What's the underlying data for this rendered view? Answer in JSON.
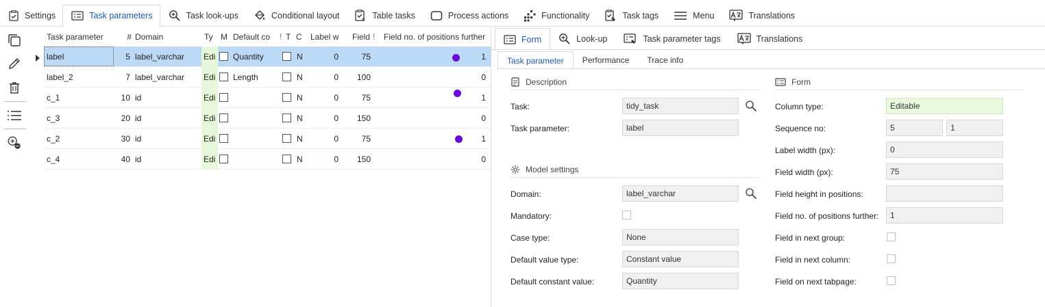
{
  "top_tabs": [
    {
      "label": "Settings",
      "icon": "checklist-icon"
    },
    {
      "label": "Task parameters",
      "icon": "form-icon",
      "active": true
    },
    {
      "label": "Task look-ups",
      "icon": "lookup-icon"
    },
    {
      "label": "Conditional layout",
      "icon": "paint-bucket-icon"
    },
    {
      "label": "Table tasks",
      "icon": "table-task-icon"
    },
    {
      "label": "Process actions",
      "icon": "rounded-rect-icon"
    },
    {
      "label": "Functionality",
      "icon": "functionality-icon"
    },
    {
      "label": "Task tags",
      "icon": "tag-icon"
    },
    {
      "label": "Menu",
      "icon": "menu-icon"
    },
    {
      "label": "Translations",
      "icon": "translate-icon"
    }
  ],
  "grid": {
    "headers": {
      "task_parameter": "Task parameter",
      "seq": "#",
      "domain": "Domain",
      "type": "Ty",
      "mandatory": "M",
      "default_const": "Default co",
      "t_hidden": "!",
      "t": "T",
      "c": "C",
      "label_width": "Label w",
      "field_width": "Field",
      "field_width_more": "!",
      "positions": "Field no. of positions further"
    },
    "rows": [
      {
        "name": "label",
        "seq": "5",
        "domain": "label_varchar",
        "type": "Edi",
        "default": "Quantity",
        "c": "N",
        "label_width": "0",
        "field_width": "75",
        "dot": true,
        "positions": "1"
      },
      {
        "name": "label_2",
        "seq": "7",
        "domain": "label_varchar",
        "type": "Edi",
        "default": "Length",
        "c": "N",
        "label_width": "0",
        "field_width": "100",
        "dot": false,
        "positions": "0"
      },
      {
        "name": "c_1",
        "seq": "10",
        "domain": "id",
        "type": "Edi",
        "default": "",
        "c": "N",
        "label_width": "0",
        "field_width": "75",
        "dot": true,
        "positions": "1"
      },
      {
        "name": "c_3",
        "seq": "20",
        "domain": "id",
        "type": "Edi",
        "default": "",
        "c": "N",
        "label_width": "0",
        "field_width": "150",
        "dot": false,
        "positions": "0"
      },
      {
        "name": "c_2",
        "seq": "30",
        "domain": "id",
        "type": "Edi",
        "default": "",
        "c": "N",
        "label_width": "0",
        "field_width": "75",
        "dot": true,
        "positions": "1"
      },
      {
        "name": "c_4",
        "seq": "40",
        "domain": "id",
        "type": "Edi",
        "default": "",
        "c": "N",
        "label_width": "0",
        "field_width": "150",
        "dot": false,
        "positions": "0"
      }
    ]
  },
  "right_tabs": [
    {
      "label": "Form",
      "icon": "form-icon",
      "active": true
    },
    {
      "label": "Look-up",
      "icon": "lookup-icon"
    },
    {
      "label": "Task parameter tags",
      "icon": "tag-icon"
    },
    {
      "label": "Translations",
      "icon": "translate-icon"
    }
  ],
  "sub_tabs": [
    {
      "label": "Task parameter",
      "active": true
    },
    {
      "label": "Performance"
    },
    {
      "label": "Trace info"
    }
  ],
  "form": {
    "description_title": "Description",
    "task_label": "Task:",
    "task_value": "tidy_task",
    "task_param_label": "Task parameter:",
    "task_param_value": "label",
    "model_title": "Model settings",
    "domain_label": "Domain:",
    "domain_value": "label_varchar",
    "mandatory_label": "Mandatory:",
    "case_label": "Case type:",
    "case_value": "None",
    "default_type_label": "Default value type:",
    "default_type_value": "Constant value",
    "default_const_label": "Default constant value:",
    "default_const_value": "Quantity",
    "form_title": "Form",
    "column_type_label": "Column type:",
    "column_type_value": "Editable",
    "sequence_label": "Sequence no:",
    "sequence_value": "5",
    "sequence_value2": "1",
    "label_width_label": "Label width (px):",
    "label_width_value": "0",
    "field_width_label": "Field width (px):",
    "field_width_value": "75",
    "field_height_label": "Field height in positions:",
    "field_height_value": "",
    "positions_label": "Field no. of positions further:",
    "positions_value": "1",
    "next_group_label": "Field in next group:",
    "next_column_label": "Field in next column:",
    "next_tabpage_label": "Field on next tabpage:"
  },
  "colors": {
    "accent": "#1e5aa8",
    "selected_row": "#bcd9f5",
    "type_cell": "#e6f7d9",
    "dot": "#6a0dd8"
  }
}
